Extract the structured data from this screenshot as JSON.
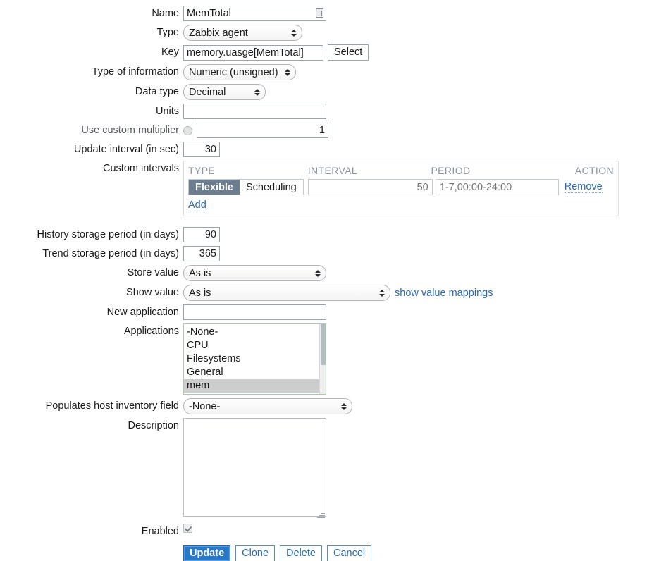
{
  "form": {
    "fields": {
      "name": {
        "label": "Name",
        "value": "MemTotal",
        "icon": "field-marker-icon"
      },
      "type": {
        "label": "Type",
        "value": "Zabbix agent"
      },
      "key": {
        "label": "Key",
        "value": "memory.uasge[MemTotal]",
        "select_button": "Select"
      },
      "type_of_information": {
        "label": "Type of information",
        "value": "Numeric (unsigned)"
      },
      "data_type": {
        "label": "Data type",
        "value": "Decimal"
      },
      "units": {
        "label": "Units",
        "value": ""
      },
      "use_custom_multiplier": {
        "label": "Use custom multiplier",
        "checked": false,
        "value": "1"
      },
      "update_interval": {
        "label": "Update interval (in sec)",
        "value": "30"
      },
      "custom_intervals": {
        "label": "Custom intervals"
      },
      "history_storage": {
        "label": "History storage period (in days)",
        "value": "90"
      },
      "trend_storage": {
        "label": "Trend storage period (in days)",
        "value": "365"
      },
      "store_value": {
        "label": "Store value",
        "value": "As is"
      },
      "show_value": {
        "label": "Show value",
        "value": "As is",
        "link": "show value mappings"
      },
      "new_application": {
        "label": "New application",
        "value": ""
      },
      "applications": {
        "label": "Applications"
      },
      "host_inventory": {
        "label": "Populates host inventory field",
        "value": "-None-"
      },
      "description": {
        "label": "Description",
        "value": ""
      },
      "enabled": {
        "label": "Enabled",
        "checked": true
      }
    },
    "custom_intervals": {
      "headers": {
        "type": "TYPE",
        "interval": "INTERVAL",
        "period": "PERIOD",
        "action": "ACTION"
      },
      "rows": [
        {
          "type_flexible": "Flexible",
          "type_scheduling": "Scheduling",
          "active_type": "Flexible",
          "interval_placeholder": "50",
          "period_placeholder": "1-7,00:00-24:00",
          "remove_label": "Remove"
        }
      ],
      "add_label": "Add"
    },
    "applications_options": [
      {
        "label": "-None-",
        "selected": false
      },
      {
        "label": "CPU",
        "selected": false
      },
      {
        "label": "Filesystems",
        "selected": false
      },
      {
        "label": "General",
        "selected": false
      },
      {
        "label": "mem",
        "selected": true
      }
    ],
    "buttons": {
      "update": "Update",
      "clone": "Clone",
      "delete": "Delete",
      "cancel": "Cancel"
    }
  },
  "colors": {
    "primary_button": "#2878c8",
    "link": "#2b6cb0",
    "segment_active": "#6b7d8f",
    "header_text": "#8b949c",
    "selected_option": "#cdcdcd",
    "focus_border_green": "#a9cba9"
  }
}
